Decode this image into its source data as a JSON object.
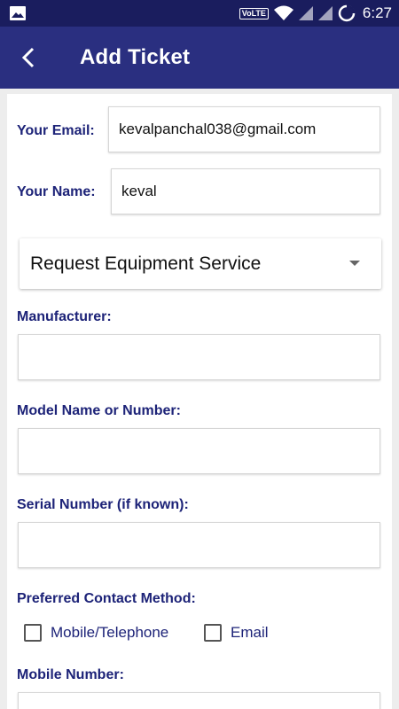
{
  "status_bar": {
    "time": "6:27",
    "network": "VoLTE",
    "icons": [
      "image-icon",
      "wifi-icon",
      "signal-icon",
      "signal-icon",
      "battery-icon"
    ]
  },
  "app_bar": {
    "title": "Add Ticket",
    "back_icon": "chevron-left-icon"
  },
  "form": {
    "email_label": "Your Email:",
    "email_value": "kevalpanchal038@gmail.com",
    "name_label": "Your Name:",
    "name_value": "keval",
    "request_type": "Request Equipment Service",
    "manufacturer_label": "Manufacturer:",
    "manufacturer_value": "",
    "model_label": "Model Name or Number:",
    "model_value": "",
    "serial_label": "Serial Number (if known):",
    "serial_value": "",
    "contact_label": "Preferred Contact Method:",
    "contact_options": [
      "Mobile/Telephone",
      "Email"
    ],
    "mobile_label": "Mobile Number:"
  }
}
